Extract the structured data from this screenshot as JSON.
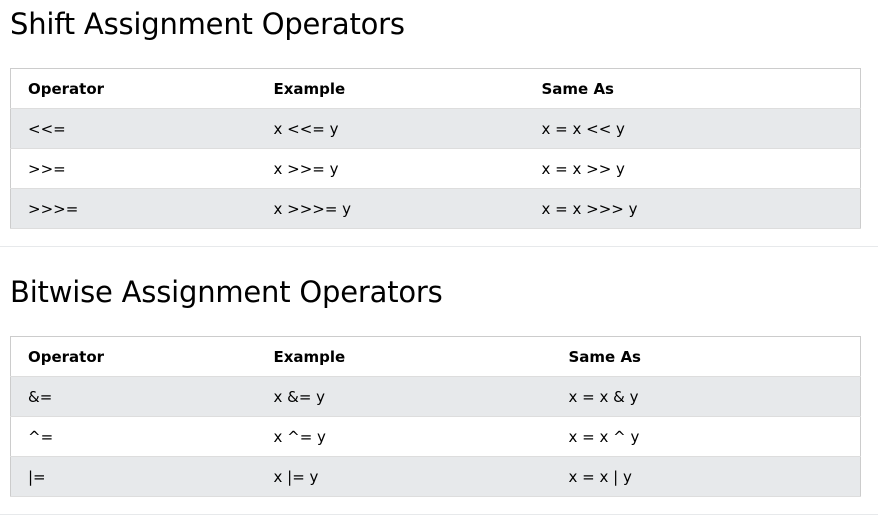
{
  "shift": {
    "title": "Shift Assignment Operators",
    "headers": [
      "Operator",
      "Example",
      "Same As"
    ],
    "rows": [
      [
        "<<=",
        "x <<= y",
        "x = x << y"
      ],
      [
        ">>=",
        "x >>= y",
        "x = x >> y"
      ],
      [
        ">>>=",
        "x >>>= y",
        "x = x >>> y"
      ]
    ]
  },
  "bitwise": {
    "title": "Bitwise Assignment Operators",
    "headers": [
      "Operator",
      "Example",
      "Same As"
    ],
    "rows": [
      [
        "&=",
        "x &= y",
        "x = x & y"
      ],
      [
        "^=",
        "x ^= y",
        "x = x ^ y"
      ],
      [
        "|=",
        "x |= y",
        "x = x | y"
      ]
    ]
  }
}
